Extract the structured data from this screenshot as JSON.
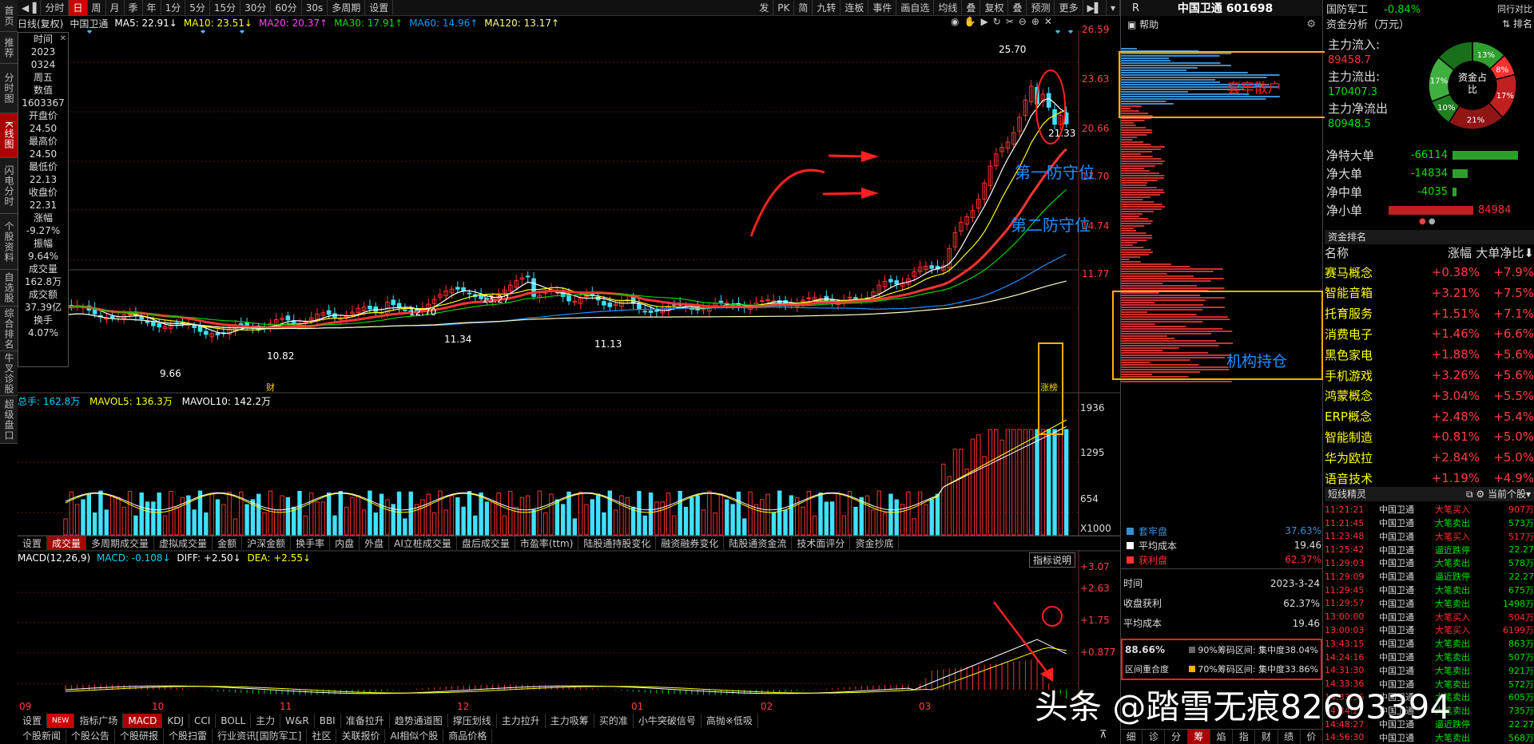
{
  "left_nav": [
    "首页",
    "推荐",
    "分时图",
    "K线图",
    "闪电分时",
    "个股资料",
    "自选股",
    "综合排名",
    "牛叉诊股",
    "超级盘口"
  ],
  "toolbar": {
    "items": [
      "分时",
      "日",
      "周",
      "月",
      "季",
      "年",
      "1分",
      "5分",
      "15分",
      "30分",
      "60分",
      "30s",
      "多周期",
      "设置"
    ],
    "right_items": [
      "发",
      "PK",
      "简",
      "九转",
      "连板",
      "事件",
      "画自选",
      "均线",
      "叠",
      "复权",
      "叠",
      "预测",
      "更多"
    ]
  },
  "ma_line": {
    "label": "日线(复权)",
    "stock": "中国卫通",
    "ma5": "MA5: 22.91↓",
    "ma10": "MA10: 23.51↓",
    "ma20": "MA20: 20.37↑",
    "ma30": "MA30: 17.91↑",
    "ma60": "MA60: 14.96↑",
    "ma120": "MA120: 13.17↑"
  },
  "info": {
    "time_lbl": "时间",
    "year": "2023",
    "date": "0324",
    "weekday": "周五",
    "num_lbl": "数值",
    "num": "1603367",
    "open_lbl": "开盘价",
    "open": "24.50",
    "high_lbl": "最高价",
    "high": "24.50",
    "low_lbl": "最低价",
    "low": "22.13",
    "close_lbl": "收盘价",
    "close": "22.31",
    "chg_lbl": "涨幅",
    "chg": "-9.27%",
    "amp_lbl": "振幅",
    "amp": "9.64%",
    "vol_lbl": "成交量",
    "vol": "162.8万",
    "amt_lbl": "成交额",
    "amt": "37.39亿",
    "turn_lbl": "换手",
    "turn": "4.07%"
  },
  "price_axis": [
    "26.59",
    "23.63",
    "20.66",
    "17.70",
    "14.74",
    "11.77"
  ],
  "price_labels": {
    "hi": "25.70",
    "lo": "21.33",
    "p1270": "12.70",
    "p1327": "13.27",
    "p1134": "11.34",
    "p1113": "11.13",
    "p1082": "10.82",
    "p966": "9.66",
    "cai": "财",
    "zhangting": "涨榜"
  },
  "annotations": {
    "trapped": "套牢散户",
    "def1": "第一防守位",
    "def2": "第二防守位",
    "inst": "机构持仓"
  },
  "volume": {
    "header_total": "总手: 162.8万",
    "mavol5": "MAVOL5: 136.3万",
    "mavol10": "MAVOL10: 142.2万",
    "axis": [
      "1936",
      "1295",
      "654",
      "X1000"
    ]
  },
  "vol_tabs": [
    "设置",
    "成交量",
    "多周期成交量",
    "虚拟成交量",
    "金额",
    "沪深金额",
    "换手率",
    "内盘",
    "外盘",
    "AI立桩成交量",
    "盘后成交量",
    "市盈率(ttm)",
    "陆股通持股变化",
    "融资融券变化",
    "陆股通资金流",
    "技术面评分",
    "资金抄底"
  ],
  "macd": {
    "header": "MACD(12,26,9)",
    "macd": "MACD: -0.108↓",
    "diff": "DIFF: +2.50↓",
    "dea": "DEA: +2.55↓",
    "help": "指标说明",
    "axis": [
      "+3.07",
      "+2.63",
      "+1.75",
      "+0.877"
    ]
  },
  "months": [
    "09",
    "10",
    "11",
    "12",
    "01",
    "02",
    "03"
  ],
  "ind_tabs": [
    "设置",
    "NEW",
    "指标广场",
    "MACD",
    "KDJ",
    "CCI",
    "BOLL",
    "主力",
    "W&R",
    "BBI",
    "准备拉升",
    "趋势通道图",
    "撑压划线",
    "主力拉升",
    "主力吸筹",
    "买的准",
    "小牛突破信号",
    "高抛※低吸"
  ],
  "bottom_tabs": [
    "个股新闻",
    "个股公告",
    "个股研报",
    "个股扫雷",
    "行业资讯[国防军工]",
    "社区",
    "关联报价",
    "AI相似个股",
    "商品价格"
  ],
  "chip": {
    "r": "R",
    "title": "中国卫通  601698",
    "help": "帮助",
    "trapped": "套牢盘",
    "trapped_v": "37.63%",
    "avg": "平均成本",
    "avg_v": "19.46",
    "profit": "获利盘",
    "profit_v": "62.37%",
    "time_lbl": "时间",
    "time_v": "2023-3-24",
    "profit_lbl": "收盘获利",
    "profit_pct": "62.37%",
    "avg_lbl": "平均成本",
    "avg_cost": "19.46",
    "conc_pct": "88.66%",
    "conc_lbl": "区间重合度",
    "r90": "90%筹码区间: 集中度38.04%",
    "r70": "70%筹码区间: 集中度33.86%",
    "tabs": [
      "细",
      "诊",
      "分",
      "筹",
      "焰",
      "指",
      "财",
      "绩",
      "价"
    ]
  },
  "fund": {
    "sector": "国防军工",
    "sector_chg": "-0.84%",
    "sync": "同行对比",
    "title": "资金分析（万元）",
    "rank": "排名",
    "in_lbl": "主力流入:",
    "in": "89458.7",
    "out_lbl": "主力流出:",
    "out": "170407.3",
    "net_lbl": "主力净流出",
    "net": "80948.5",
    "donut": "资金占比",
    "pcts": [
      "13%",
      "8%",
      "17%",
      "21%",
      "10%",
      "17%",
      "10%"
    ],
    "bars": [
      {
        "label": "净特大单",
        "value": "-66114"
      },
      {
        "label": "净大单",
        "value": "-14834"
      },
      {
        "label": "净中单",
        "value": "-4035"
      },
      {
        "label": "净小单",
        "value": "84984"
      }
    ]
  },
  "ranking": {
    "title": "资金排名",
    "h_name": "名称",
    "h_chg": "涨幅",
    "h_net": "大单净比",
    "rows": [
      [
        "赛马概念",
        "+0.38%",
        "+7.9%"
      ],
      [
        "智能音箱",
        "+3.21%",
        "+7.5%"
      ],
      [
        "托育服务",
        "+1.51%",
        "+7.1%"
      ],
      [
        "消费电子",
        "+1.46%",
        "+6.6%"
      ],
      [
        "黑色家电",
        "+1.88%",
        "+5.6%"
      ],
      [
        "手机游戏",
        "+3.26%",
        "+5.6%"
      ],
      [
        "鸿蒙概念",
        "+3.04%",
        "+5.5%"
      ],
      [
        "ERP概念",
        "+2.48%",
        "+5.4%"
      ],
      [
        "智能制造",
        "+0.81%",
        "+5.0%"
      ],
      [
        "华为欧拉",
        "+2.84%",
        "+5.0%"
      ],
      [
        "语音技术",
        "+1.19%",
        "+4.9%"
      ]
    ]
  },
  "ticks": {
    "title": "短线精灵",
    "scope": "当前个股",
    "rows": [
      [
        "11:21:21",
        "中国卫通",
        "大笔买入",
        "907万",
        "r"
      ],
      [
        "11:21:45",
        "中国卫通",
        "大笔卖出",
        "573万",
        "g"
      ],
      [
        "11:23:48",
        "中国卫通",
        "大笔买入",
        "517万",
        "r"
      ],
      [
        "11:25:42",
        "中国卫通",
        "逼近跌停",
        "22.27",
        "g"
      ],
      [
        "11:29:03",
        "中国卫通",
        "大笔卖出",
        "578万",
        "g"
      ],
      [
        "11:29:09",
        "中国卫通",
        "逼近跌停",
        "22.27",
        "g"
      ],
      [
        "11:29:45",
        "中国卫通",
        "大笔卖出",
        "675万",
        "g"
      ],
      [
        "11:29:57",
        "中国卫通",
        "大笔卖出",
        "1498万",
        "g"
      ],
      [
        "13:00:00",
        "中国卫通",
        "大笔买入",
        "504万",
        "r"
      ],
      [
        "13:00:03",
        "中国卫通",
        "大笔买入",
        "6199万",
        "r"
      ],
      [
        "13:43:15",
        "中国卫通",
        "大笔卖出",
        "863万",
        "g"
      ],
      [
        "14:24:16",
        "中国卫通",
        "大笔卖出",
        "507万",
        "g"
      ],
      [
        "14:31:30",
        "中国卫通",
        "大笔卖出",
        "921万",
        "g"
      ],
      [
        "14:33:36",
        "中国卫通",
        "大笔卖出",
        "572万",
        "g"
      ],
      [
        "14:33:36",
        "中国卫通",
        "大笔卖出",
        "605万",
        "g"
      ],
      [
        "14:34:27",
        "中国卫通",
        "大笔卖出",
        "735万",
        "g"
      ],
      [
        "14:48:27",
        "中国卫通",
        "逼近跌停",
        "22.27",
        "g"
      ],
      [
        "14:56:30",
        "中国卫通",
        "大笔卖出",
        "568万",
        "g"
      ]
    ]
  },
  "watermark": "头条 @踏雪无痕82693394"
}
